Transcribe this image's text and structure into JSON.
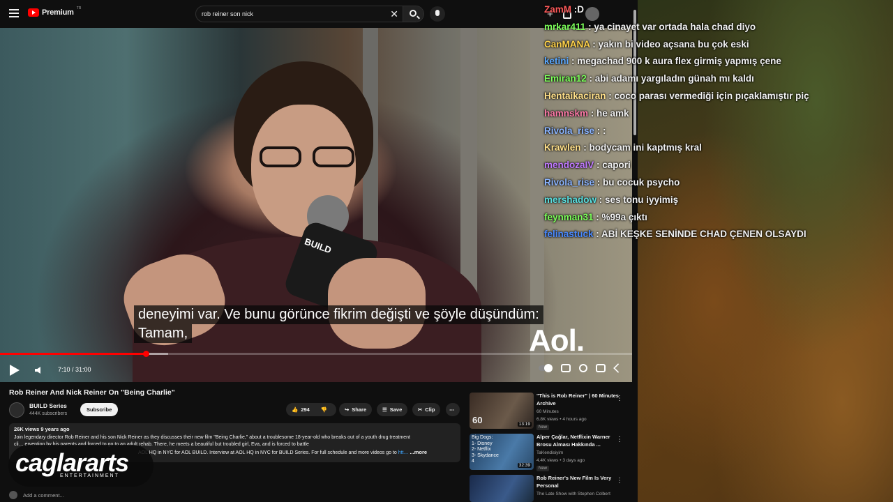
{
  "topbar": {
    "logo": "Premium",
    "logo_sup": "TR",
    "search_value": "rob reiner son nick"
  },
  "player": {
    "caption_line1": "deneyimi var.  Ve bunu görünce fikrim değişti ve şöyle düşündüm:",
    "caption_line2": "Tamam,",
    "watermark": "Aol.",
    "mic_brand": "BUILD",
    "time": "7:10 / 31:00",
    "progress_fraction": 0.231,
    "buffer_fraction": 0.266
  },
  "video_info": {
    "title": "Rob Reiner And Nick Reiner On \"Being Charlie\"",
    "channel": "BUILD Series",
    "subscribers": "444K subscribers",
    "subscribe_label": "Subscribe",
    "likes": "294",
    "share_label": "Share",
    "save_label": "Save",
    "clip_label": "Clip",
    "views": "26K views  9 years ago",
    "desc_line1": "Join legendary director Rob Reiner and his son Nick Reiner as they discusses their new film \"Being Charlie,\" about a troublesome 18-year-old who breaks out of a youth drug treatment",
    "desc_line2": "cli…                                                ervention by his parents and forced to go to an adult rehab. There, he meets a beautiful but troubled girl, Eva, and is forced to battle",
    "desc_line3": "AOL HQ in NYC for AOL BUILD. Interview at AOL HQ in NYC for BUILD Series. For full schedule and more videos go to",
    "desc_link": "htt…",
    "desc_more": "...more",
    "comment_placeholder": "Add a comment..."
  },
  "related": [
    {
      "title": "\"This is Rob Reiner\" | 60 Minutes Archive",
      "channel": "60 Minutes",
      "meta": "6.8K views • 4 hours ago",
      "badge": "New",
      "duration": "13:19",
      "thumb_text": "60"
    },
    {
      "title": "Alper Çağlar, Netflixin Warner Brosu Alması Hakkında ...",
      "channel": "TaKendisiyim",
      "meta": "4.4K views • 3 days ago",
      "badge": "New",
      "duration": "32:39",
      "thumb_text": "Big Dogs:\n1- Disney\n2- Netflix\n3- Skydance\n4"
    },
    {
      "title": "Rob Reiner's New Film Is Very Personal",
      "channel": "The Late Show with Stephen Colbert",
      "meta": "",
      "badge": "",
      "duration": "",
      "thumb_text": ""
    }
  ],
  "chat": [
    {
      "user": "ZamM",
      "text": ":D",
      "color": "#ff5a5a"
    },
    {
      "user": "mrkar411",
      "text": "ya cinayet var ortada hala chad diyo",
      "color": "#7cff5a"
    },
    {
      "user": "CanMANA",
      "text": "yakın bi video açsana bu çok eski",
      "color": "#ffd24a"
    },
    {
      "user": "ketini",
      "text": "megachad 900 k aura flex girmiş yapmış çene",
      "color": "#5aa8ff"
    },
    {
      "user": "Emiran12",
      "text": "abi adamı yargıladın günah mı kaldı",
      "color": "#7cff5a"
    },
    {
      "user": "Hentaikaciran",
      "text": "coco parası vermediği için pıçaklamıştır piç",
      "color": "#ffe08a"
    },
    {
      "user": "hamnskm",
      "text": "he amk",
      "color": "#ff7aa8"
    },
    {
      "user": "Rivola_rise",
      "text": ":",
      "color": "#8ab4ff"
    },
    {
      "user": "Krawlen",
      "text": "bodycam ini kaptmış kral",
      "color": "#ffe08a"
    },
    {
      "user": "mendozaIV",
      "text": "capori",
      "color": "#c07aff"
    },
    {
      "user": "Rivola_rise",
      "text": "bu cocuk psycho",
      "color": "#8ab4ff"
    },
    {
      "user": "mershadow",
      "text": "ses tonu iyyimiş",
      "color": "#5ae0e0"
    },
    {
      "user": "feynman31",
      "text": "%99a çıktı",
      "color": "#7cff5a"
    },
    {
      "user": "felinastuck",
      "text": "ABİ KEŞKE SENİNDE CHAD ÇENEN OLSAYDI",
      "color": "#4a8aff"
    }
  ],
  "brand": {
    "name": "caglararts",
    "sub": "ENTERTAINMENT"
  }
}
